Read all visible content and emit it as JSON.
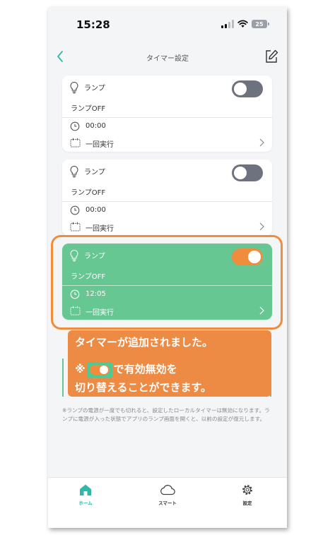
{
  "status_bar": {
    "time": "15:28",
    "battery": "25"
  },
  "nav": {
    "title": "タイマー設定"
  },
  "timers": [
    {
      "device": "ランプ",
      "action": "ランプOFF",
      "time": "00:00",
      "repeat": "一回実行",
      "enabled": false
    },
    {
      "device": "ランプ",
      "action": "ランプOFF",
      "time": "00:00",
      "repeat": "一回実行",
      "enabled": false
    },
    {
      "device": "ランプ",
      "action": "ランプOFF",
      "time": "12:05",
      "repeat": "一回実行",
      "enabled": true
    }
  ],
  "callout": {
    "line1": "タイマーが追加されました。",
    "mark": "※",
    "line2": "で有効無効を",
    "line3": "切り替えることができます。"
  },
  "note": "※ランプの電源が一度でも切れると、設定したローカルタイマーは無効になります。ランプに電源が入った状態でアプリのランプ画面を開くと、以前の設定が復元します。",
  "tabs": [
    {
      "label": "ホーム",
      "icon": "home-icon",
      "active": true
    },
    {
      "label": "スマート",
      "icon": "cloud-icon",
      "active": false
    },
    {
      "label": "設定",
      "icon": "gear-icon",
      "active": false
    }
  ],
  "colors": {
    "accent": "#2fb7a9",
    "active_card": "#66c792",
    "toggle_on": "#f08d3c",
    "toggle_off": "#6d727e",
    "callout": "#ed8a44",
    "highlight_frame": "#f08d3c"
  }
}
